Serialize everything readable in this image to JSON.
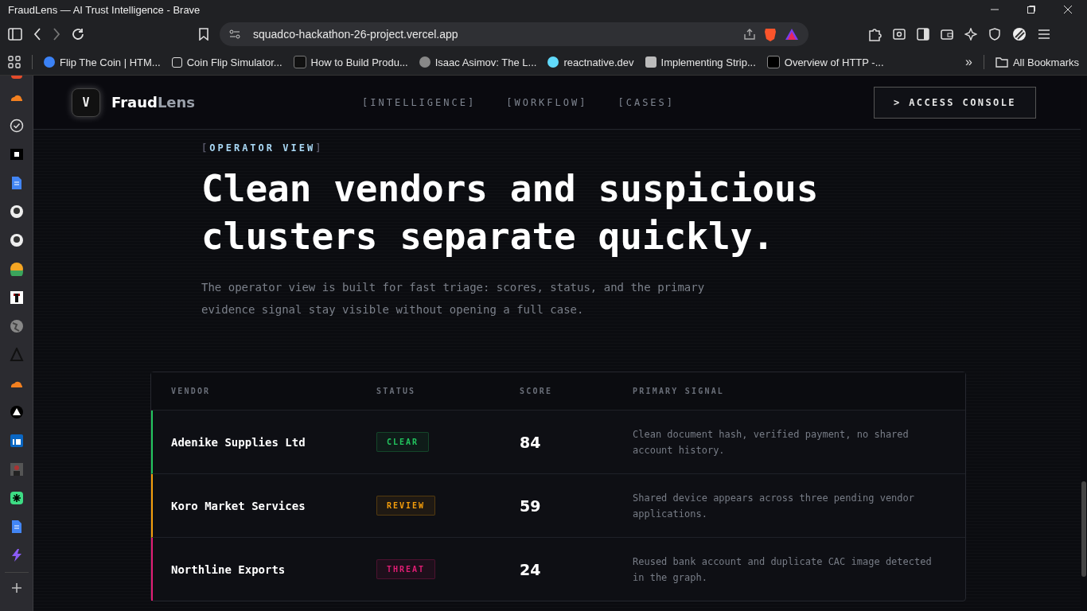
{
  "window": {
    "title": "FraudLens — AI Trust Intelligence - Brave"
  },
  "address_bar": {
    "url": "squadco-hackathon-26-project.vercel.app"
  },
  "bookmarks": [
    {
      "label": "Flip The Coin | HTM..."
    },
    {
      "label": "Coin Flip Simulator..."
    },
    {
      "label": "How to Build Produ..."
    },
    {
      "label": "Isaac Asimov: The L..."
    },
    {
      "label": "reactnative.dev"
    },
    {
      "label": "Implementing Strip..."
    },
    {
      "label": "Overview of HTTP -..."
    }
  ],
  "bookmarks_more": "»",
  "all_bookmarks": "All Bookmarks",
  "site": {
    "logo": "V",
    "brand": "Fraud",
    "brand_accent": "Lens",
    "nav": [
      {
        "label": "[INTELLIGENCE]"
      },
      {
        "label": "[WORKFLOW]"
      },
      {
        "label": "[CASES]"
      }
    ],
    "console_button": "> ACCESS CONSOLE"
  },
  "hero": {
    "eyebrow_open": "[",
    "eyebrow": "OPERATOR VIEW",
    "eyebrow_close": "]",
    "headline": "Clean vendors and suspicious clusters separate quickly.",
    "description": "The operator view is built for fast triage: scores, status, and the primary evidence signal stay visible without opening a full case."
  },
  "table": {
    "columns": [
      "VENDOR",
      "STATUS",
      "SCORE",
      "PRIMARY SIGNAL"
    ],
    "rows": [
      {
        "vendor": "Adenike Supplies Ltd",
        "status": "CLEAR",
        "color": "#22c55e",
        "score": "84",
        "signal": "Clean document hash, verified payment, no shared account history."
      },
      {
        "vendor": "Koro Market Services",
        "status": "REVIEW",
        "color": "#f59e0b",
        "score": "59",
        "signal": "Shared device appears across three pending vendor applications."
      },
      {
        "vendor": "Northline Exports",
        "status": "THREAT",
        "color": "#e11d74",
        "score": "24",
        "signal": "Reused bank account and duplicate CAC image detected in the graph."
      }
    ]
  }
}
